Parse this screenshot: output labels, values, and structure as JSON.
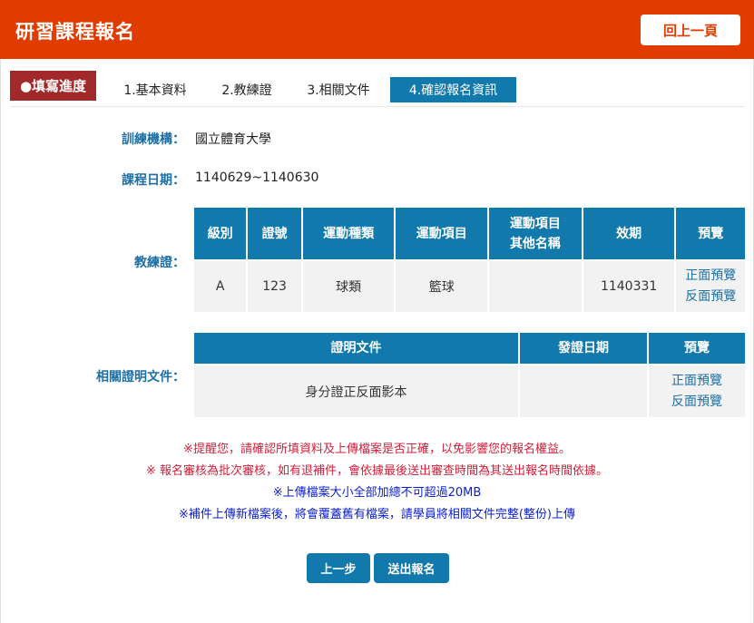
{
  "header": {
    "title": "研習課程報名",
    "back_label": "回上一頁"
  },
  "progress": {
    "label": "●填寫進度",
    "tabs": [
      {
        "label": "1.基本資料"
      },
      {
        "label": "2.教練證"
      },
      {
        "label": "3.相關文件"
      },
      {
        "label": "4.確認報名資訊"
      }
    ]
  },
  "fields": {
    "institution": {
      "label": "訓練機構：",
      "value": "國立體育大學"
    },
    "course_date": {
      "label": "課程日期：",
      "value": "1140629~1140630"
    },
    "coach_cert": {
      "label": "教練證："
    },
    "related_docs": {
      "label": "相關證明文件："
    }
  },
  "cert_table": {
    "headers": [
      "級別",
      "證號",
      "運動種類",
      "運動項目",
      "運動項目其他名稱",
      "效期",
      "預覽"
    ],
    "headers_split": {
      "other_name_line1": "運動項目",
      "other_name_line2": "其他名稱"
    },
    "rows": [
      {
        "level": "A",
        "number": "123",
        "sport_type": "球類",
        "sport_item": "籃球",
        "other_name": "",
        "validity": "1140331",
        "preview_front": "正面預覽",
        "preview_back": "反面預覽"
      }
    ]
  },
  "doc_table": {
    "headers": [
      "證明文件",
      "發證日期",
      "預覽"
    ],
    "rows": [
      {
        "document": "身分證正反面影本",
        "issue_date": "",
        "preview_front": "正面預覽",
        "preview_back": "反面預覽"
      }
    ]
  },
  "notes": [
    "※提醒您，請確認所填資料及上傳檔案是否正確，以免影響您的報名權益。",
    "※ 報名審核為批次審核，如有退補件，會依據最後送出審查時間為其送出報名時間依據。",
    "※上傳檔案大小全部加總不可超過20MB",
    "※補件上傳新檔案後，將會覆蓋舊有檔案，請學員將相關文件完整(整份)上傳"
  ],
  "buttons": {
    "prev": "上一步",
    "submit": "送出報名"
  },
  "colors": {
    "header": "#e03c00",
    "accent": "#1179ab",
    "progress_label": "#a2292a",
    "note_red": "#d0213b",
    "note_blue": "#0b1fcf"
  }
}
